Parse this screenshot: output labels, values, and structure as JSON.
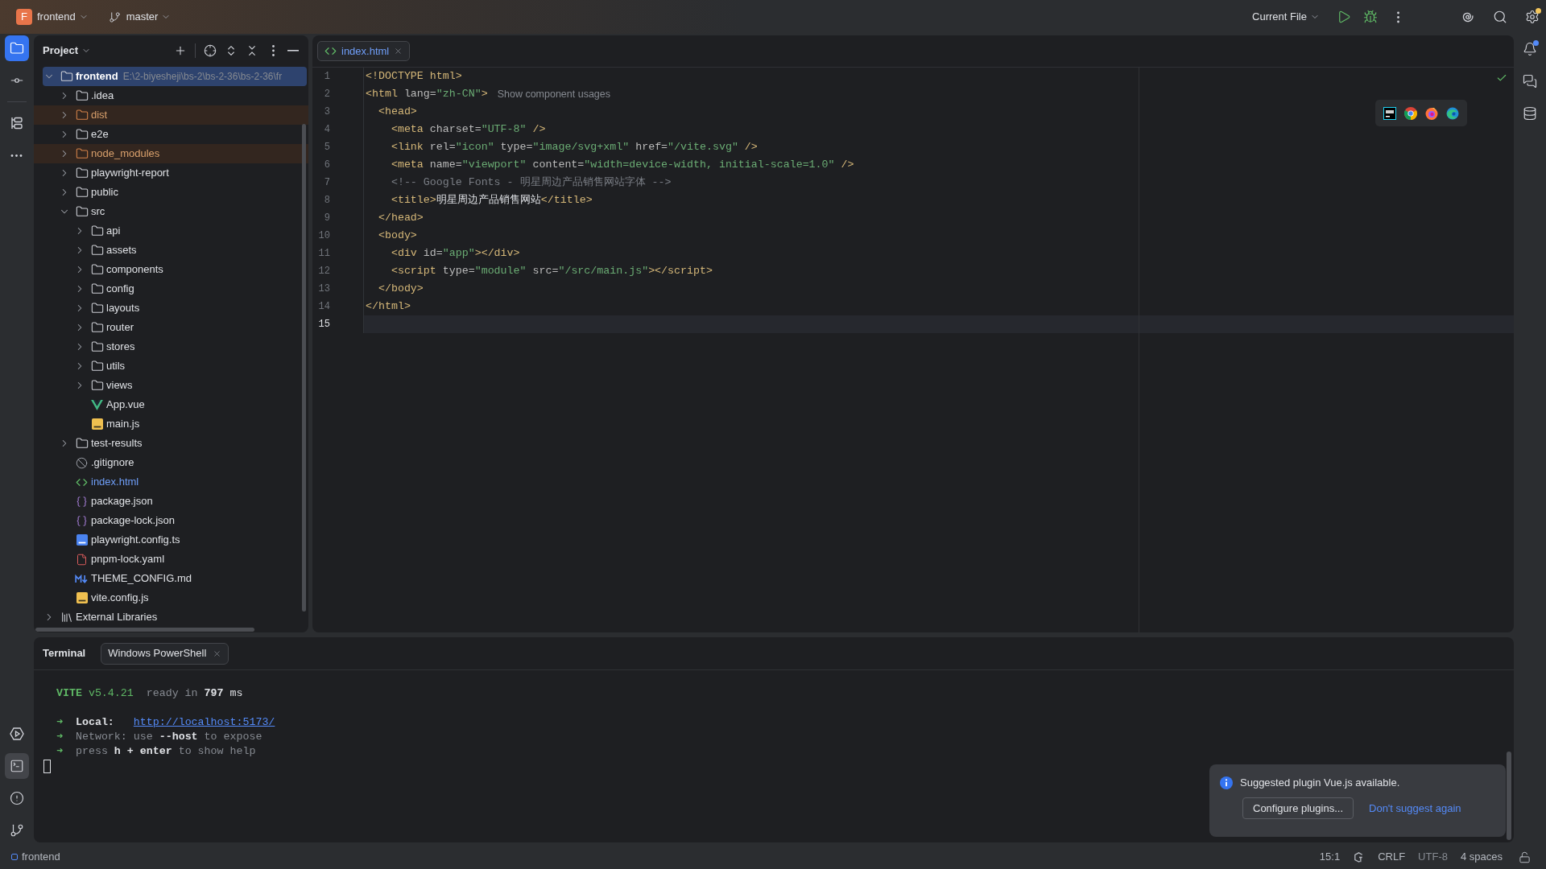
{
  "title_bar": {
    "project_badge": "F",
    "project": "frontend",
    "branch": "master",
    "run_configuration": "Current File",
    "settings_update": true
  },
  "tool_strip": {
    "top_groups": [
      [
        {
          "kind": "project",
          "selected": true
        },
        {
          "kind": "commit",
          "selected": false
        }
      ],
      [
        {
          "kind": "structure",
          "selected": false
        },
        {
          "kind": "more",
          "selected": false
        }
      ]
    ],
    "bottom": [
      {
        "kind": "run",
        "selected": false
      },
      {
        "kind": "terminal",
        "selected": true
      },
      {
        "kind": "problems",
        "selected": false
      },
      {
        "kind": "git",
        "selected": false
      }
    ]
  },
  "right_strip": {
    "items": [
      {
        "kind": "notifications",
        "unread": true
      },
      {
        "kind": "ai_chat",
        "unread": false
      },
      {
        "kind": "database",
        "unread": false
      }
    ]
  },
  "project_panel": {
    "title": "Project",
    "tree": [
      {
        "name": "frontend",
        "path": "E:\\2-biyesheji\\bs-2\\bs-2-36\\bs-2-36\\fr",
        "kind": "module",
        "expanded": true,
        "selected": true,
        "excluded": false,
        "modified": false,
        "children": [
          {
            "name": ".idea",
            "kind": "folder",
            "expanded": false,
            "selected": false,
            "excluded": false,
            "modified": false
          },
          {
            "name": "dist",
            "kind": "folder",
            "expanded": false,
            "selected": false,
            "excluded": true,
            "modified": false
          },
          {
            "name": "e2e",
            "kind": "folder",
            "expanded": false,
            "selected": false,
            "excluded": false,
            "modified": false
          },
          {
            "name": "node_modules",
            "kind": "folder",
            "expanded": false,
            "selected": false,
            "excluded": true,
            "modified": false
          },
          {
            "name": "playwright-report",
            "kind": "folder",
            "expanded": false,
            "selected": false,
            "excluded": false,
            "modified": false
          },
          {
            "name": "public",
            "kind": "folder",
            "expanded": false,
            "selected": false,
            "excluded": false,
            "modified": false
          },
          {
            "name": "src",
            "kind": "folder",
            "expanded": true,
            "selected": false,
            "excluded": false,
            "modified": false,
            "children": [
              {
                "name": "api",
                "kind": "folder",
                "expanded": false,
                "selected": false,
                "excluded": false,
                "modified": false
              },
              {
                "name": "assets",
                "kind": "folder",
                "expanded": false,
                "selected": false,
                "excluded": false,
                "modified": false
              },
              {
                "name": "components",
                "kind": "folder",
                "expanded": false,
                "selected": false,
                "excluded": false,
                "modified": false
              },
              {
                "name": "config",
                "kind": "folder",
                "expanded": false,
                "selected": false,
                "excluded": false,
                "modified": false
              },
              {
                "name": "layouts",
                "kind": "folder",
                "expanded": false,
                "selected": false,
                "excluded": false,
                "modified": false
              },
              {
                "name": "router",
                "kind": "folder",
                "expanded": false,
                "selected": false,
                "excluded": false,
                "modified": false
              },
              {
                "name": "stores",
                "kind": "folder",
                "expanded": false,
                "selected": false,
                "excluded": false,
                "modified": false
              },
              {
                "name": "utils",
                "kind": "folder",
                "expanded": false,
                "selected": false,
                "excluded": false,
                "modified": false
              },
              {
                "name": "views",
                "kind": "folder",
                "expanded": false,
                "selected": false,
                "excluded": false,
                "modified": false
              },
              {
                "name": "App.vue",
                "kind": "vue",
                "selected": false,
                "excluded": false,
                "modified": false
              },
              {
                "name": "main.js",
                "kind": "js",
                "selected": false,
                "excluded": false,
                "modified": false
              }
            ]
          },
          {
            "name": "test-results",
            "kind": "folder",
            "expanded": false,
            "selected": false,
            "excluded": false,
            "modified": false
          },
          {
            "name": ".gitignore",
            "kind": "gitignore",
            "selected": false,
            "excluded": false,
            "modified": false
          },
          {
            "name": "index.html",
            "kind": "html",
            "selected": false,
            "excluded": false,
            "modified": true
          },
          {
            "name": "package.json",
            "kind": "json",
            "selected": false,
            "excluded": false,
            "modified": false
          },
          {
            "name": "package-lock.json",
            "kind": "json",
            "selected": false,
            "excluded": false,
            "modified": false
          },
          {
            "name": "playwright.config.ts",
            "kind": "ts",
            "selected": false,
            "excluded": false,
            "modified": false
          },
          {
            "name": "pnpm-lock.yaml",
            "kind": "yaml",
            "selected": false,
            "excluded": false,
            "modified": false
          },
          {
            "name": "THEME_CONFIG.md",
            "kind": "md",
            "selected": false,
            "excluded": false,
            "modified": false
          },
          {
            "name": "vite.config.js",
            "kind": "js",
            "selected": false,
            "excluded": false,
            "modified": false
          }
        ]
      },
      {
        "name": "External Libraries",
        "kind": "libraries",
        "expanded": false,
        "selected": false,
        "excluded": false,
        "modified": false
      }
    ]
  },
  "editor": {
    "tabs": [
      {
        "label": "index.html",
        "kind": "html",
        "selected": true,
        "modified": true
      }
    ],
    "no_problems": true,
    "browsers": [
      {
        "kind": "ide"
      },
      {
        "kind": "chrome"
      },
      {
        "kind": "firefox"
      },
      {
        "kind": "edge"
      }
    ],
    "lines": [
      {
        "number": "1",
        "current": false,
        "tokens": [
          {
            "text": "<!DOCTYPE html>",
            "kind": "tag"
          }
        ]
      },
      {
        "number": "2",
        "current": false,
        "tokens": [
          {
            "text": "<html",
            "kind": "tag"
          },
          {
            "text": " lang=",
            "kind": "attr"
          },
          {
            "text": "\"zh-CN\"",
            "kind": "value"
          },
          {
            "text": ">",
            "kind": "tag"
          }
        ],
        "hint": "Show component usages"
      },
      {
        "number": "3",
        "current": false,
        "tokens": [
          {
            "text": "  <head>",
            "kind": "tag"
          }
        ]
      },
      {
        "number": "4",
        "current": false,
        "tokens": [
          {
            "text": "    <meta",
            "kind": "tag"
          },
          {
            "text": " charset=",
            "kind": "attr"
          },
          {
            "text": "\"UTF-8\"",
            "kind": "value"
          },
          {
            "text": " />",
            "kind": "tag"
          }
        ]
      },
      {
        "number": "5",
        "current": false,
        "tokens": [
          {
            "text": "    <link",
            "kind": "tag"
          },
          {
            "text": " rel=",
            "kind": "attr"
          },
          {
            "text": "\"icon\"",
            "kind": "value"
          },
          {
            "text": " type=",
            "kind": "attr"
          },
          {
            "text": "\"image/svg+xml\"",
            "kind": "value"
          },
          {
            "text": " href=",
            "kind": "attr"
          },
          {
            "text": "\"/vite.svg\"",
            "kind": "value"
          },
          {
            "text": " />",
            "kind": "tag"
          }
        ]
      },
      {
        "number": "6",
        "current": false,
        "tokens": [
          {
            "text": "    <meta",
            "kind": "tag"
          },
          {
            "text": " name=",
            "kind": "attr"
          },
          {
            "text": "\"viewport\"",
            "kind": "value"
          },
          {
            "text": " content=",
            "kind": "attr"
          },
          {
            "text": "\"width=device-width, initial-scale=1.0\"",
            "kind": "value"
          },
          {
            "text": " />",
            "kind": "tag"
          }
        ]
      },
      {
        "number": "7",
        "current": false,
        "tokens": [
          {
            "text": "    <!-- Google Fonts - 明星周边产品销售网站字体 -->",
            "kind": "comment"
          }
        ]
      },
      {
        "number": "8",
        "current": false,
        "tokens": [
          {
            "text": "    <title>",
            "kind": "tag"
          },
          {
            "text": "明星周边产品销售网站",
            "kind": "text"
          },
          {
            "text": "</title>",
            "kind": "tag"
          }
        ]
      },
      {
        "number": "9",
        "current": false,
        "tokens": [
          {
            "text": "  </head>",
            "kind": "tag"
          }
        ]
      },
      {
        "number": "10",
        "current": false,
        "tokens": [
          {
            "text": "  <body>",
            "kind": "tag"
          }
        ]
      },
      {
        "number": "11",
        "current": false,
        "tokens": [
          {
            "text": "    <div",
            "kind": "tag"
          },
          {
            "text": " id=",
            "kind": "attr"
          },
          {
            "text": "\"app\"",
            "kind": "value"
          },
          {
            "text": "></div>",
            "kind": "tag"
          }
        ]
      },
      {
        "number": "12",
        "current": false,
        "tokens": [
          {
            "text": "    <script",
            "kind": "tag"
          },
          {
            "text": " type=",
            "kind": "attr"
          },
          {
            "text": "\"module\"",
            "kind": "value"
          },
          {
            "text": " src=",
            "kind": "attr"
          },
          {
            "text": "\"/src/main.js\"",
            "kind": "value"
          },
          {
            "text": "></script>",
            "kind": "tag"
          }
        ]
      },
      {
        "number": "13",
        "current": false,
        "tokens": [
          {
            "text": "  </body>",
            "kind": "tag"
          }
        ]
      },
      {
        "number": "14",
        "current": false,
        "tokens": [
          {
            "text": "</html>",
            "kind": "tag"
          }
        ]
      },
      {
        "number": "15",
        "current": true
      }
    ]
  },
  "terminal": {
    "title": "Terminal",
    "tabs": [
      {
        "label": "Windows PowerShell",
        "selected": true
      }
    ],
    "cursor": true,
    "blocks": [
      [
        {
          "segments": [
            {
              "text": "VITE",
              "kind": "brand"
            },
            {
              "text": " v5.4.21",
              "kind": "accent"
            },
            {
              "text": "  ready in ",
              "kind": "dim"
            },
            {
              "text": "797",
              "kind": "bold"
            },
            {
              "text": " ms",
              "kind": "plain"
            }
          ]
        }
      ],
      [
        {
          "segments": [
            {
              "text": "➜",
              "kind": "accent"
            },
            {
              "text": "  Local:   ",
              "kind": "bold"
            },
            {
              "text": "http://localhost:5173/",
              "kind": "link"
            }
          ]
        },
        {
          "segments": [
            {
              "text": "➜",
              "kind": "accent"
            },
            {
              "text": "  Network: use ",
              "kind": "dim"
            },
            {
              "text": "--host",
              "kind": "bold"
            },
            {
              "text": " to expose",
              "kind": "dim"
            }
          ]
        },
        {
          "segments": [
            {
              "text": "➜",
              "kind": "accent"
            },
            {
              "text": "  press ",
              "kind": "dim"
            },
            {
              "text": "h + enter",
              "kind": "bold"
            },
            {
              "text": " to show help",
              "kind": "dim"
            }
          ]
        }
      ]
    ]
  },
  "notification": {
    "message": "Suggested plugin Vue.js available.",
    "actions": [
      {
        "label": "Configure plugins...",
        "kind": "button"
      },
      {
        "label": "Don't suggest again",
        "kind": "link"
      }
    ]
  },
  "status_bar": {
    "project": "frontend",
    "caret": "15:1",
    "line_separator": "CRLF",
    "encoding": "UTF-8",
    "indent": "4 spaces",
    "read_only": false
  }
}
